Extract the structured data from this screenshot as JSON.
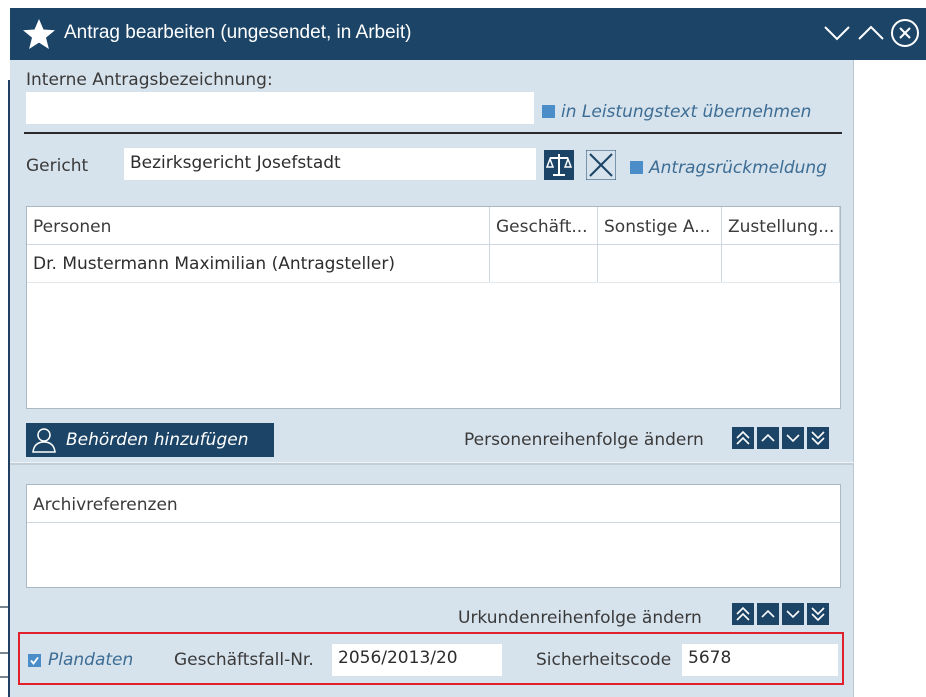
{
  "window": {
    "title": "Antrag bearbeiten (ungesendet, in Arbeit)",
    "icons": [
      "star-icon",
      "chevron-down-icon",
      "chevron-up-icon",
      "close-circle-icon"
    ]
  },
  "form": {
    "internal_label": "Interne Antragsbezeichnung:",
    "internal_value": "",
    "take_over_label": "in Leistungstext übernehmen",
    "court_label": "Gericht",
    "court_value": "Bezirksgericht Josefstadt",
    "feedback_label": "Antragsrückmeldung"
  },
  "persons_table": {
    "columns": [
      "Personen",
      "Geschäft...",
      "Sonstige A...",
      "Zustellung..."
    ],
    "rows": [
      [
        "Dr. Mustermann Maximilian (Antragsteller)",
        "",
        "",
        ""
      ]
    ]
  },
  "actions": {
    "add_authorities": "Behörden hinzufügen",
    "person_order_label": "Personenreihenfolge ändern",
    "document_order_label": "Urkundenreihenfolge ändern"
  },
  "archive_table": {
    "columns": [
      "Archivreferenzen"
    ],
    "rows": []
  },
  "footer": {
    "plandaten_label": "Plandaten",
    "plandaten_checked": true,
    "case_no_label": "Geschäftsfall-Nr.",
    "case_no_value": "2056/2013/20",
    "security_label": "Sicherheitscode",
    "security_value": "5678"
  },
  "colors": {
    "titlebar": "#1b4467",
    "dialog_bg": "#d6e2ec",
    "accent": "#4a8dc8",
    "highlight": "#e0202a"
  }
}
